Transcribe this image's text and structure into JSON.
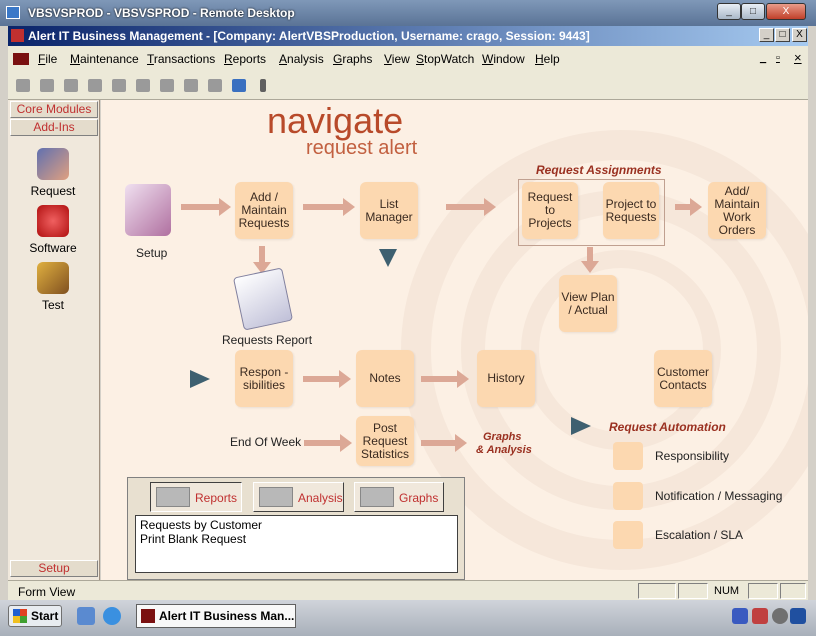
{
  "rd_window": {
    "title": "VBSVSPROD - VBSVSPROD - Remote Desktop",
    "min": "_",
    "max": "□",
    "close": "X"
  },
  "app_window": {
    "title": "Alert IT Business Management - [Company: AlertVBSProduction, Username: crago, Session: 9443]",
    "min": "_",
    "max": "□",
    "close": "X"
  },
  "menu": {
    "items": [
      "File",
      "Maintenance",
      "Transactions",
      "Reports",
      "Analysis",
      "Graphs",
      "View",
      "StopWatch",
      "Window",
      "Help"
    ],
    "mdi_min": "_",
    "mdi_max": "▫",
    "mdi_close": "×"
  },
  "toolbar": {
    "icons": [
      "binoculars-icon",
      "new-icon",
      "print-icon",
      "save-icon",
      "undo-icon",
      "delete-icon",
      "cut-icon",
      "copy-icon",
      "paste-icon",
      "export-icon"
    ]
  },
  "left_panel": {
    "core_modules": "Core Modules",
    "add_ins": "Add-Ins",
    "setup": "Setup",
    "modules": [
      {
        "label": "Request",
        "icon": "request-icon"
      },
      {
        "label": "Software",
        "icon": "software-icon"
      },
      {
        "label": "Test",
        "icon": "test-icon"
      }
    ]
  },
  "main": {
    "title": "navigate",
    "subtitle": "request alert",
    "setup_label": "Setup",
    "add_maintain": "Add / Maintain Requests",
    "list_manager": "List Manager",
    "request_assignments": "Request Assignments",
    "request_to_projects": "Request to Projects",
    "project_to_requests": "Project to Requests",
    "add_work_orders": "Add/ Maintain Work Orders",
    "view_plan": "View Plan / Actual",
    "requests_report": "Requests Report",
    "responsibilities": "Respon - sibilities",
    "notes": "Notes",
    "history": "History",
    "customer_contacts": "Customer Contacts",
    "end_of_week": "End Of Week",
    "post_request_stats": "Post Request Statistics",
    "graphs_analysis_1": "Graphs",
    "graphs_analysis_2": "& Analysis",
    "request_automation": "Request Automation",
    "automation_items": [
      "Responsibility",
      "Notification / Messaging",
      "Escalation / SLA"
    ]
  },
  "report_panel": {
    "tabs": [
      "Reports",
      "Analysis",
      "Graphs"
    ],
    "list": [
      "Requests by Customer",
      "Print Blank Request"
    ]
  },
  "status": {
    "text": "Form View",
    "num": "NUM"
  },
  "taskbar": {
    "start": "Start",
    "task_item": "Alert IT Business Man..."
  }
}
